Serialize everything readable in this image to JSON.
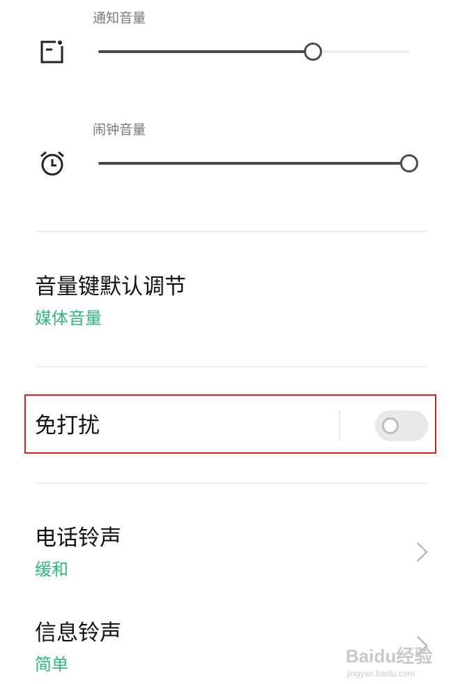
{
  "sliders": [
    {
      "label": "通知音量",
      "icon": "notification-icon",
      "level": 0.69
    },
    {
      "label": "闹钟音量",
      "icon": "alarm-clock-icon",
      "level": 1.0
    }
  ],
  "volume_key": {
    "title": "音量键默认调节",
    "value": "媒体音量"
  },
  "do_not_disturb": {
    "title": "免打扰",
    "enabled": false,
    "highlight_color": "#e0201a"
  },
  "ringtones": [
    {
      "title": "电话铃声",
      "value": "缓和"
    },
    {
      "title": "信息铃声",
      "value": "简单"
    }
  ],
  "accent_color": "#2db87a",
  "watermark": {
    "main": "Baidu经验",
    "sub": "jingyan.baidu.com"
  }
}
